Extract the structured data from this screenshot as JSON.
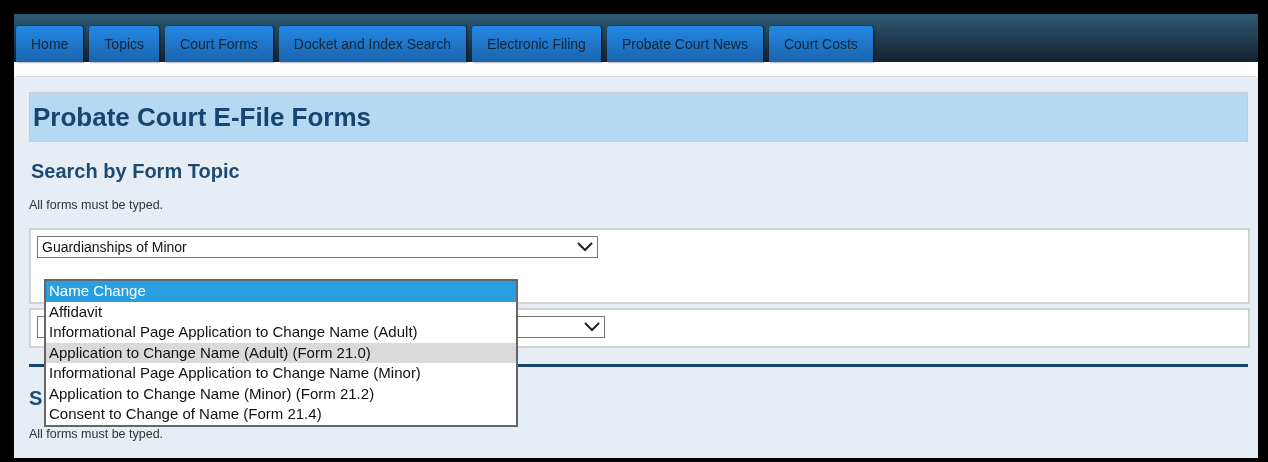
{
  "tabs": [
    {
      "label": "Home"
    },
    {
      "label": "Topics"
    },
    {
      "label": "Court Forms"
    },
    {
      "label": "Docket and Index Search"
    },
    {
      "label": "Electronic Filing"
    },
    {
      "label": "Probate Court News"
    },
    {
      "label": "Court Costs"
    }
  ],
  "page_title": "Probate Court E-File Forms",
  "section": {
    "heading": "Search by Form Topic",
    "note": "All forms must be typed."
  },
  "topic_select": {
    "value": "Guardianships of Minor"
  },
  "form_select": {
    "expanded": true,
    "options": [
      {
        "label": "Name Change",
        "selected": true,
        "hovered": false
      },
      {
        "label": "Affidavit",
        "selected": false,
        "hovered": false
      },
      {
        "label": "Informational Page Application to Change Name (Adult)",
        "selected": false,
        "hovered": false
      },
      {
        "label": "Application to Change Name (Adult) (Form 21.0)",
        "selected": false,
        "hovered": true
      },
      {
        "label": "Informational Page Application to Change Name (Minor)",
        "selected": false,
        "hovered": false
      },
      {
        "label": "Application to Change Name (Minor) (Form 21.2)",
        "selected": false,
        "hovered": false
      },
      {
        "label": "Consent to Change of Name (Form 21.4)",
        "selected": false,
        "hovered": false
      }
    ]
  },
  "section_2": {
    "heading": "S",
    "note": "All forms must be typed."
  }
}
